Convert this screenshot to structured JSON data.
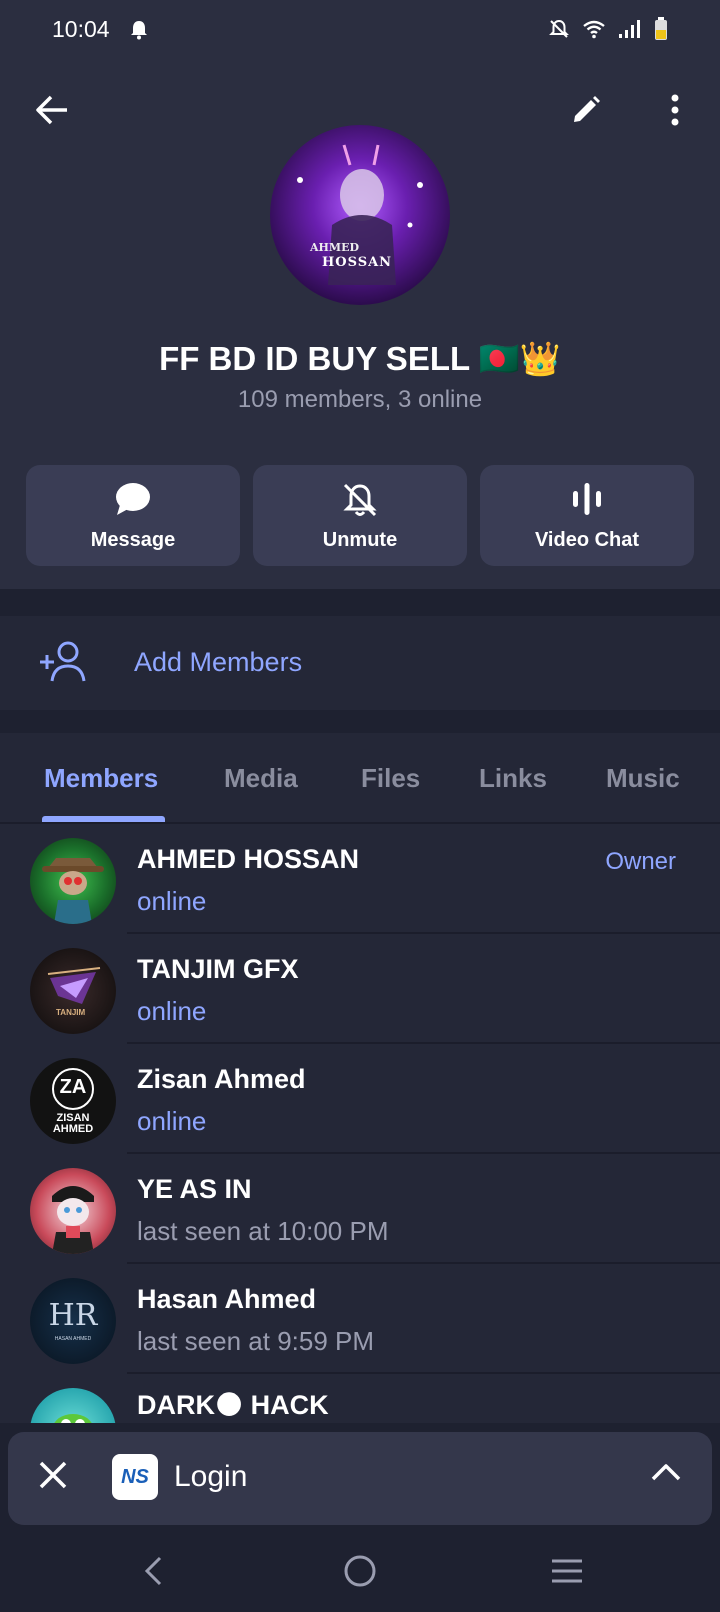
{
  "status_bar": {
    "time": "10:04"
  },
  "header": {
    "avatar_text_line1": "AHMED",
    "avatar_text_line2": "HOSSAN",
    "title": "FF BD ID BUY SELL 🇧🇩👑",
    "subtitle": "109 members, 3 online",
    "icons": [
      "back-arrow-icon",
      "edit-pencil-icon",
      "more-vert-icon"
    ]
  },
  "actions": [
    {
      "label": "Message",
      "icon": "chat-bubble-icon"
    },
    {
      "label": "Unmute",
      "icon": "bell-off-icon"
    },
    {
      "label": "Video Chat",
      "icon": "voice-bars-icon"
    }
  ],
  "add_members": {
    "label": "Add Members",
    "icon": "add-person-icon"
  },
  "tabs": [
    {
      "label": "Members",
      "active": true
    },
    {
      "label": "Media"
    },
    {
      "label": "Files"
    },
    {
      "label": "Links"
    },
    {
      "label": "Music"
    }
  ],
  "members": [
    {
      "name": "AHMED HOSSAN",
      "status": "online",
      "role": "Owner"
    },
    {
      "name": "TANJIM GFX",
      "status": "online",
      "avatar_text": "TANJIM"
    },
    {
      "name": "Zisan Ahmed",
      "status": "online",
      "avatar_text_top": "ZA",
      "avatar_text_bottom1": "ZISAN",
      "avatar_text_bottom2": "AHMED"
    },
    {
      "name": "YE AS IN",
      "status": "last seen at 10:00 PM"
    },
    {
      "name": "Hasan Ahmed",
      "status": "last seen at 9:59 PM",
      "avatar_text": "HR",
      "avatar_subtext": "HASAN AHMED"
    },
    {
      "name": "DARK🌑 HACK",
      "status": ""
    }
  ],
  "bottom_bar": {
    "label": "Login",
    "logo_text": "NS"
  },
  "colors": {
    "header_bg": "#2b2e40",
    "list_bg": "#242737",
    "accent": "#8fa6ff",
    "button_bg": "#3a3d55"
  }
}
